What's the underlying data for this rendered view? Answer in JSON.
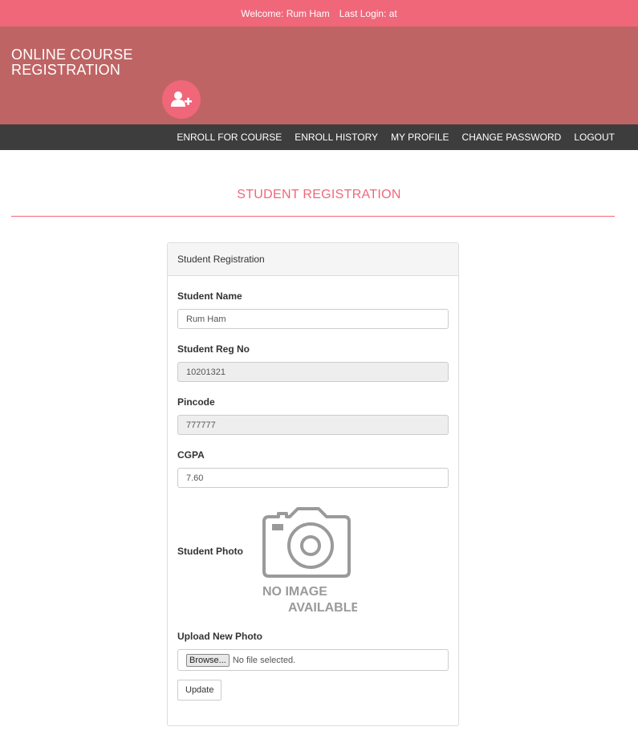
{
  "topbar": {
    "welcome_label": "Welcome:",
    "user_name": "Rum Ham",
    "last_login": "Last Login: at"
  },
  "brand": {
    "line1": "ONLINE COURSE",
    "line2": "REGISTRATION",
    "icon": "user-plus-icon"
  },
  "nav": {
    "items": [
      {
        "label": "ENROLL FOR COURSE"
      },
      {
        "label": "ENROLL HISTORY"
      },
      {
        "label": "MY PROFILE"
      },
      {
        "label": "CHANGE PASSWORD"
      },
      {
        "label": "LOGOUT"
      }
    ]
  },
  "page": {
    "heading": "STUDENT REGISTRATION"
  },
  "panel": {
    "title": "Student Registration"
  },
  "form": {
    "student_name": {
      "label": "Student Name",
      "value": "Rum Ham"
    },
    "reg_no": {
      "label": "Student Reg No",
      "value": "10201321"
    },
    "pincode": {
      "label": "Pincode",
      "value": "777777"
    },
    "cgpa": {
      "label": "CGPA",
      "value": "7.60"
    },
    "photo": {
      "label": "Student Photo",
      "placeholder_line1": "NO IMAGE",
      "placeholder_line2": "AVAILABLE",
      "icon": "camera-icon"
    },
    "upload": {
      "label": "Upload New Photo",
      "browse_label": "Browse...",
      "status": "No file selected."
    },
    "submit_label": "Update"
  },
  "colors": {
    "accent": "#f0677a",
    "banner": "#bf6464",
    "navbar": "#3d3d3d"
  }
}
